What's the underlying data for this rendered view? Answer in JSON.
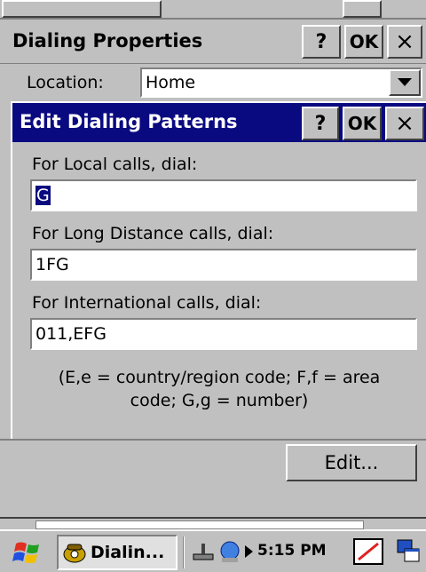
{
  "outer_window": {
    "title": "Dialing Properties",
    "help_label": "?",
    "ok_label": "OK",
    "close_label": "×",
    "location_label": "Location:",
    "location_value": "Home"
  },
  "dialog": {
    "title": "Edit Dialing Patterns",
    "help_label": "?",
    "ok_label": "OK",
    "close_label": "×",
    "local_label": "For Local calls, dial:",
    "local_value": "G",
    "long_distance_label": "For Long Distance calls, dial:",
    "long_distance_value": "1FG",
    "international_label": "For International calls, dial:",
    "international_value": "011,EFG",
    "help_text_line1": "(E,e = country/region code; F,f = area",
    "help_text_line2": "code; G,g = number)"
  },
  "edit_button_label": "Edit...",
  "taskbar": {
    "task_label": "Dialin...",
    "time": "5:15 PM"
  },
  "colors": {
    "dialog_titlebar": "#0a0a80",
    "window_face": "#c0c0c0",
    "selection": "#0a0a80"
  }
}
